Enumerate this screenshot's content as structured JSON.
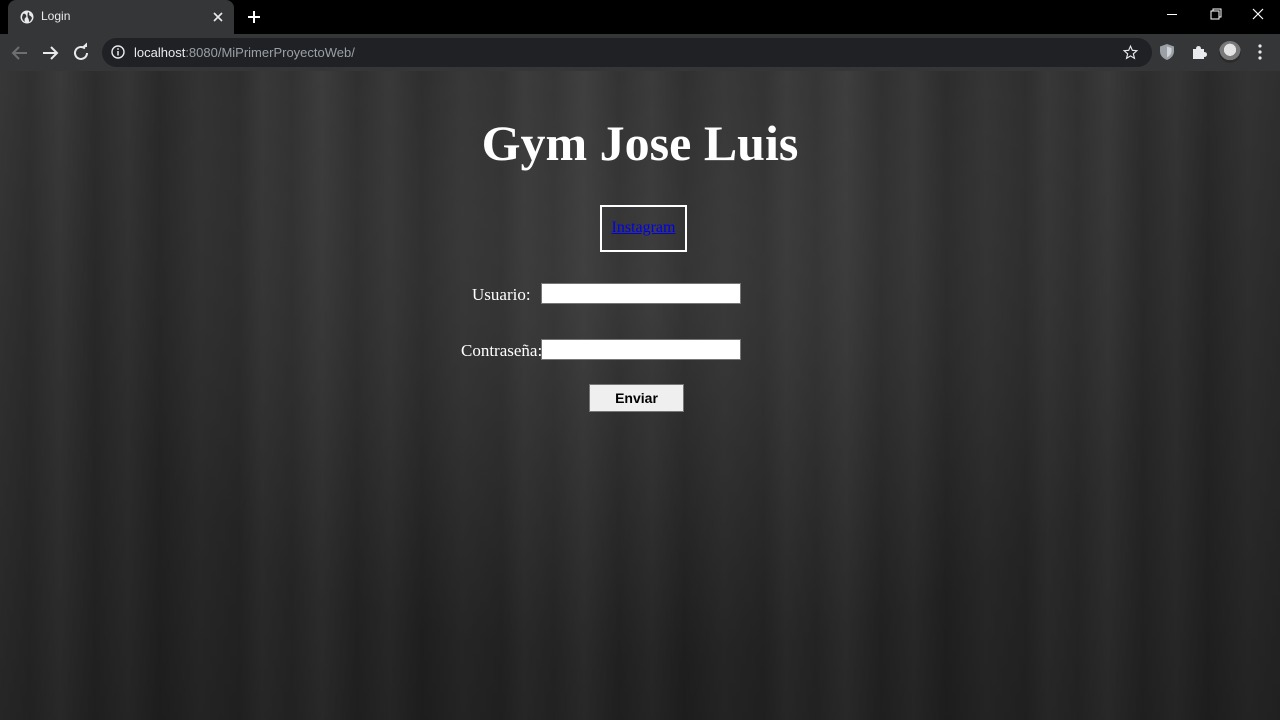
{
  "browser": {
    "tab_title": "Login",
    "new_tab_symbol": "+",
    "url_host": "localhost",
    "url_rest": ":8080/MiPrimerProyectoWeb/"
  },
  "page": {
    "title": "Gym Jose Luis",
    "instagram_link": "Instagram",
    "usuario_label": "Usuario:",
    "contrasena_label": "Contraseña:",
    "submit_label": "Enviar"
  },
  "icons": [
    "globe-icon",
    "close-icon",
    "plus-icon",
    "minimize-icon",
    "restore-icon",
    "window-close-icon",
    "back-icon",
    "forward-icon",
    "reload-icon",
    "info-icon",
    "star-icon",
    "shield-icon",
    "puzzle-icon",
    "avatar",
    "more-icon"
  ]
}
